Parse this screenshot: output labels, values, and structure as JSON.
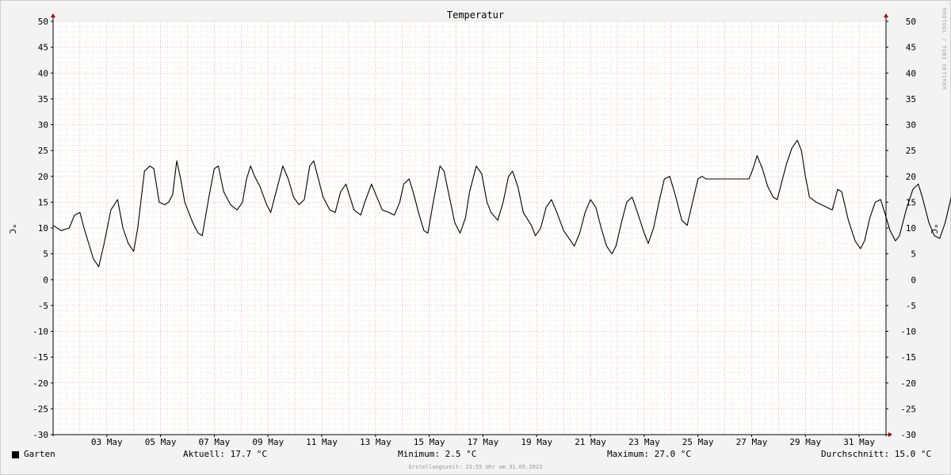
{
  "chart_data": {
    "type": "line",
    "title": "Temperatur",
    "ylabel": "°C",
    "ylabel_right": "°C",
    "ylim": [
      -30,
      50
    ],
    "y_ticks": [
      -30,
      -25,
      -20,
      -15,
      -10,
      -5,
      0,
      5,
      10,
      15,
      20,
      25,
      30,
      35,
      40,
      45,
      50
    ],
    "x_range_days": [
      1.0,
      32.0
    ],
    "x_tick_labels": [
      {
        "day": 3,
        "label": "03 May"
      },
      {
        "day": 5,
        "label": "05 May"
      },
      {
        "day": 7,
        "label": "07 May"
      },
      {
        "day": 9,
        "label": "09 May"
      },
      {
        "day": 11,
        "label": "11 May"
      },
      {
        "day": 13,
        "label": "13 May"
      },
      {
        "day": 15,
        "label": "15 May"
      },
      {
        "day": 17,
        "label": "17 May"
      },
      {
        "day": 19,
        "label": "19 May"
      },
      {
        "day": 21,
        "label": "21 May"
      },
      {
        "day": 23,
        "label": "23 May"
      },
      {
        "day": 25,
        "label": "25 May"
      },
      {
        "day": 27,
        "label": "27 May"
      },
      {
        "day": 29,
        "label": "29 May"
      },
      {
        "day": 31,
        "label": "31 May"
      }
    ],
    "grid": true,
    "legend_position": "bottom-left",
    "series": [
      {
        "name": "Garten",
        "color": "#000000",
        "points": [
          [
            1.0,
            10.5
          ],
          [
            1.3,
            9.5
          ],
          [
            1.6,
            10.0
          ],
          [
            1.8,
            12.5
          ],
          [
            2.0,
            13.0
          ],
          [
            2.15,
            10.0
          ],
          [
            2.5,
            4.0
          ],
          [
            2.7,
            2.5
          ],
          [
            2.9,
            7.0
          ],
          [
            3.15,
            13.5
          ],
          [
            3.4,
            15.5
          ],
          [
            3.6,
            10.0
          ],
          [
            3.8,
            7.0
          ],
          [
            4.0,
            5.5
          ],
          [
            4.15,
            10.0
          ],
          [
            4.4,
            21.0
          ],
          [
            4.6,
            22.0
          ],
          [
            4.75,
            21.5
          ],
          [
            4.95,
            15.0
          ],
          [
            5.15,
            14.5
          ],
          [
            5.3,
            15.0
          ],
          [
            5.45,
            16.5
          ],
          [
            5.6,
            23.0
          ],
          [
            5.75,
            19.5
          ],
          [
            5.9,
            15.0
          ],
          [
            6.2,
            11.0
          ],
          [
            6.4,
            9.0
          ],
          [
            6.55,
            8.5
          ],
          [
            6.8,
            16.0
          ],
          [
            7.0,
            21.5
          ],
          [
            7.15,
            22.0
          ],
          [
            7.35,
            17.0
          ],
          [
            7.6,
            14.5
          ],
          [
            7.85,
            13.5
          ],
          [
            8.05,
            15.0
          ],
          [
            8.2,
            19.5
          ],
          [
            8.35,
            22.0
          ],
          [
            8.5,
            20.0
          ],
          [
            8.7,
            18.0
          ],
          [
            8.95,
            14.5
          ],
          [
            9.1,
            13.0
          ],
          [
            9.3,
            17.0
          ],
          [
            9.55,
            22.0
          ],
          [
            9.75,
            19.5
          ],
          [
            9.95,
            16.0
          ],
          [
            10.15,
            14.5
          ],
          [
            10.35,
            15.5
          ],
          [
            10.55,
            22.0
          ],
          [
            10.7,
            23.0
          ],
          [
            10.85,
            20.0
          ],
          [
            11.05,
            16.0
          ],
          [
            11.3,
            13.5
          ],
          [
            11.5,
            13.0
          ],
          [
            11.7,
            17.0
          ],
          [
            11.9,
            18.5
          ],
          [
            12.05,
            16.0
          ],
          [
            12.2,
            13.5
          ],
          [
            12.45,
            12.5
          ],
          [
            12.6,
            15.0
          ],
          [
            12.85,
            18.5
          ],
          [
            13.05,
            16.0
          ],
          [
            13.25,
            13.5
          ],
          [
            13.5,
            13.0
          ],
          [
            13.7,
            12.5
          ],
          [
            13.9,
            15.0
          ],
          [
            14.05,
            18.5
          ],
          [
            14.25,
            19.5
          ],
          [
            14.4,
            17.0
          ],
          [
            14.6,
            13.0
          ],
          [
            14.8,
            9.5
          ],
          [
            14.95,
            9.0
          ],
          [
            15.15,
            15.0
          ],
          [
            15.4,
            22.0
          ],
          [
            15.55,
            21.0
          ],
          [
            15.75,
            16.0
          ],
          [
            15.95,
            11.0
          ],
          [
            16.15,
            9.0
          ],
          [
            16.35,
            12.0
          ],
          [
            16.5,
            17.0
          ],
          [
            16.75,
            22.0
          ],
          [
            16.95,
            20.5
          ],
          [
            17.15,
            15.0
          ],
          [
            17.3,
            13.0
          ],
          [
            17.55,
            11.5
          ],
          [
            17.75,
            15.0
          ],
          [
            17.95,
            20.0
          ],
          [
            18.1,
            21.0
          ],
          [
            18.3,
            18.0
          ],
          [
            18.5,
            13.0
          ],
          [
            18.8,
            10.5
          ],
          [
            18.95,
            8.5
          ],
          [
            19.15,
            10.0
          ],
          [
            19.35,
            14.0
          ],
          [
            19.55,
            15.5
          ],
          [
            19.75,
            13.0
          ],
          [
            20.0,
            9.5
          ],
          [
            20.2,
            8.0
          ],
          [
            20.4,
            6.5
          ],
          [
            20.6,
            9.0
          ],
          [
            20.8,
            13.0
          ],
          [
            21.0,
            15.5
          ],
          [
            21.2,
            14.0
          ],
          [
            21.4,
            10.0
          ],
          [
            21.6,
            6.5
          ],
          [
            21.8,
            5.0
          ],
          [
            21.95,
            6.5
          ],
          [
            22.15,
            11.0
          ],
          [
            22.35,
            15.0
          ],
          [
            22.55,
            16.0
          ],
          [
            22.75,
            13.0
          ],
          [
            23.0,
            9.0
          ],
          [
            23.15,
            7.0
          ],
          [
            23.35,
            10.0
          ],
          [
            23.55,
            15.0
          ],
          [
            23.75,
            19.5
          ],
          [
            23.95,
            20.0
          ],
          [
            24.15,
            16.5
          ],
          [
            24.4,
            11.5
          ],
          [
            24.6,
            10.5
          ],
          [
            24.8,
            15.0
          ],
          [
            25.0,
            19.5
          ],
          [
            25.15,
            20.0
          ],
          [
            25.3,
            19.5
          ],
          [
            26.9,
            19.5
          ],
          [
            27.05,
            21.5
          ],
          [
            27.2,
            24.0
          ],
          [
            27.4,
            21.5
          ],
          [
            27.6,
            18.0
          ],
          [
            27.8,
            16.0
          ],
          [
            27.95,
            15.5
          ],
          [
            28.1,
            18.5
          ],
          [
            28.3,
            22.5
          ],
          [
            28.5,
            25.5
          ],
          [
            28.7,
            27.0
          ],
          [
            28.85,
            25.0
          ],
          [
            29.0,
            20.0
          ],
          [
            29.15,
            16.0
          ],
          [
            29.4,
            15.0
          ],
          [
            29.6,
            14.5
          ],
          [
            29.8,
            14.0
          ],
          [
            30.0,
            13.5
          ],
          [
            30.2,
            17.5
          ],
          [
            30.35,
            17.0
          ],
          [
            30.6,
            11.5
          ],
          [
            30.85,
            7.5
          ],
          [
            31.05,
            6.0
          ],
          [
            31.2,
            7.5
          ],
          [
            31.4,
            12.0
          ],
          [
            31.6,
            15.0
          ],
          [
            31.8,
            15.5
          ],
          [
            31.95,
            13.0
          ],
          [
            32.15,
            9.5
          ],
          [
            32.35,
            7.5
          ],
          [
            32.5,
            8.5
          ],
          [
            32.75,
            13.5
          ],
          [
            33.0,
            17.5
          ],
          [
            33.2,
            18.5
          ],
          [
            33.35,
            16.0
          ],
          [
            33.6,
            11.0
          ],
          [
            33.8,
            8.5
          ],
          [
            34.0,
            8.0
          ],
          [
            34.2,
            11.0
          ],
          [
            34.45,
            16.5
          ],
          [
            34.6,
            18.5
          ],
          [
            34.75,
            18.0
          ],
          [
            35.0,
            12.5
          ],
          [
            35.2,
            8.0
          ],
          [
            35.4,
            7.5
          ],
          [
            35.65,
            12.0
          ],
          [
            35.9,
            18.5
          ],
          [
            36.1,
            22.0
          ],
          [
            36.3,
            22.5
          ],
          [
            36.45,
            18.0
          ],
          [
            36.7,
            11.0
          ],
          [
            36.9,
            9.5
          ],
          [
            37.1,
            14.0
          ],
          [
            37.3,
            20.0
          ],
          [
            37.5,
            24.5
          ],
          [
            37.7,
            24.0
          ],
          [
            37.9,
            18.0
          ],
          [
            38.1,
            11.0
          ],
          [
            38.3,
            10.0
          ],
          [
            38.5,
            14.0
          ],
          [
            38.7,
            19.0
          ],
          [
            38.9,
            20.5
          ],
          [
            39.1,
            18.0
          ],
          [
            39.35,
            11.5
          ],
          [
            39.6,
            9.0
          ],
          [
            39.8,
            10.5
          ],
          [
            40.0,
            16.0
          ],
          [
            40.2,
            20.0
          ],
          [
            40.4,
            21.0
          ],
          [
            40.6,
            15.0
          ],
          [
            40.8,
            11.5
          ],
          [
            41.0,
            10.0
          ],
          [
            41.2,
            12.0
          ],
          [
            41.45,
            19.0
          ],
          [
            41.65,
            24.5
          ],
          [
            41.85,
            24.5
          ],
          [
            42.0,
            22.5
          ],
          [
            42.1,
            19.0
          ],
          [
            42.2,
            17.7
          ]
        ]
      }
    ]
  },
  "legend": {
    "label": "Garten",
    "swatch_color": "#000000"
  },
  "stats": {
    "current": "Aktuell: 17.7 °C",
    "minimum": "Minimum: 2.5 °C",
    "maximum": "Maximum: 27.0 °C",
    "average": "Durchschnitt: 15.0 °C"
  },
  "timestamp": "Erstellungszeit: 23:55 Uhr am 31.05.2023",
  "watermark": "RRDTOOL / TOBI OETIKER",
  "colors": {
    "background": "#f3f3f3",
    "plot_background": "#ffffff",
    "grid_minor": "#e2c2c2",
    "grid_major": "#e08080",
    "axis": "#000000",
    "arrow": "#a00000"
  }
}
